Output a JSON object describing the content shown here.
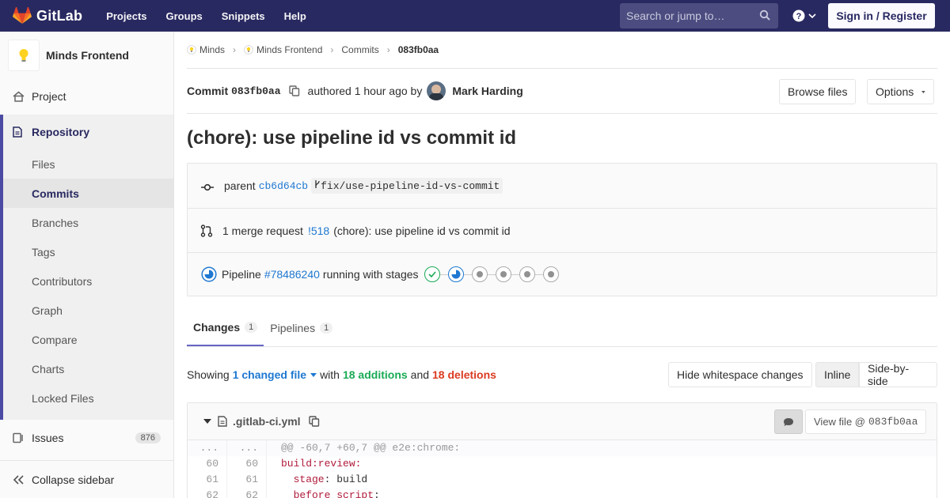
{
  "nav": {
    "brand": "GitLab",
    "links": [
      "Projects",
      "Groups",
      "Snippets",
      "Help"
    ],
    "search_placeholder": "Search or jump to…",
    "signin": "Sign in / Register"
  },
  "sidebar": {
    "project_name": "Minds Frontend",
    "project": "Project",
    "repository": "Repository",
    "repo_items": [
      "Files",
      "Commits",
      "Branches",
      "Tags",
      "Contributors",
      "Graph",
      "Compare",
      "Charts",
      "Locked Files"
    ],
    "active_item": "Commits",
    "issues": "Issues",
    "issues_count": "876",
    "collapse": "Collapse sidebar"
  },
  "breadcrumb": [
    "Minds",
    "Minds Frontend",
    "Commits",
    "083fb0aa"
  ],
  "commit": {
    "label": "Commit",
    "sha": "083fb0aa",
    "authored": "authored 1 hour ago by",
    "author": "Mark Harding",
    "browse": "Browse files",
    "options": "Options",
    "title": "(chore): use pipeline id vs commit id"
  },
  "info": {
    "parent_label": "parent",
    "parent_sha": "cb6d64cb",
    "branch": "fix/use-pipeline-id-vs-commit",
    "mr_text": "1 merge request",
    "mr_id": "!518",
    "mr_title": "(chore): use pipeline id vs commit id",
    "pipeline_label": "Pipeline",
    "pipeline_id": "#78486240",
    "pipeline_status": "running with stages"
  },
  "stages": [
    "success",
    "running",
    "created",
    "created",
    "created",
    "created"
  ],
  "tabs": [
    {
      "label": "Changes",
      "count": "1"
    },
    {
      "label": "Pipelines",
      "count": "1"
    }
  ],
  "diffstat": {
    "showing": "Showing",
    "files": "1 changed file",
    "with": "with",
    "additions": "18 additions",
    "and": "and",
    "deletions": "18 deletions",
    "hide_ws": "Hide whitespace changes",
    "inline": "Inline",
    "side": "Side-by-side"
  },
  "file": {
    "name": ".gitlab-ci.yml",
    "view_label": "View file @",
    "view_sha": "083fb0aa"
  },
  "diff": [
    {
      "old": "...",
      "new": "...",
      "hunk": true,
      "text": "@@ -60,7 +60,7 @@ e2e:chrome:"
    },
    {
      "old": "60",
      "new": "60",
      "hunk": false,
      "key": "build:review:",
      "rest": ""
    },
    {
      "old": "61",
      "new": "61",
      "hunk": false,
      "key": "  stage",
      "rest": ": build"
    },
    {
      "old": "62",
      "new": "62",
      "hunk": false,
      "key": "  before_script",
      "rest": ":"
    }
  ]
}
